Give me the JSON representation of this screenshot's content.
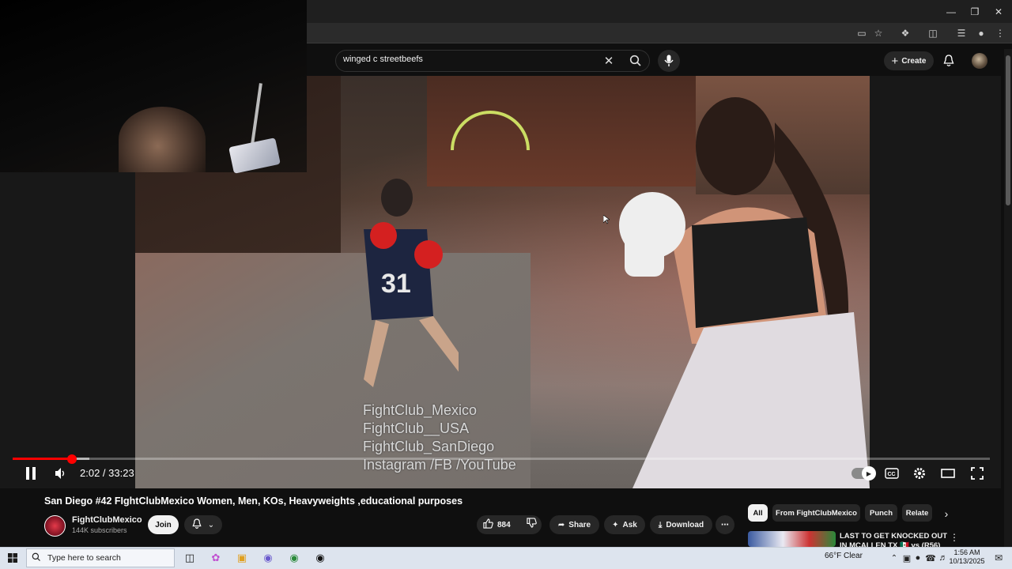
{
  "search": {
    "query": "winged c streetbeefs"
  },
  "header": {
    "create_label": "Create"
  },
  "player": {
    "time": "2:02 / 33:23",
    "progress_fraction": 0.0608,
    "watermark": [
      "FightClub_Mexico",
      "FightClub__USA",
      "FightClub_SanDiego",
      "Instagram /FB /YouTube"
    ]
  },
  "video": {
    "title": "San Diego #42 FIghtClubMexico Women, Men, KOs, Heavyweights ,educational purposes",
    "channel": "FightClubMexico",
    "subscribers": "144K subscribers",
    "join_label": "Join",
    "likes": "884",
    "share_label": "Share",
    "ask_label": "Ask",
    "download_label": "Download"
  },
  "chips": [
    "All",
    "From FightClubMexico",
    "Punch",
    "Relate"
  ],
  "recommendation": {
    "title": "LAST TO GET KNOCKED OUT IN MCALLEN TX 🇲🇽 vs (R56)"
  },
  "taskbar": {
    "search_placeholder": "Type here to search",
    "weather": "66°F  Clear",
    "time": "1:56 AM",
    "date": "10/13/2025"
  },
  "colors": {
    "accent": "#ff0000",
    "bg": "#0f0f0f",
    "chip_bg": "#272727"
  }
}
